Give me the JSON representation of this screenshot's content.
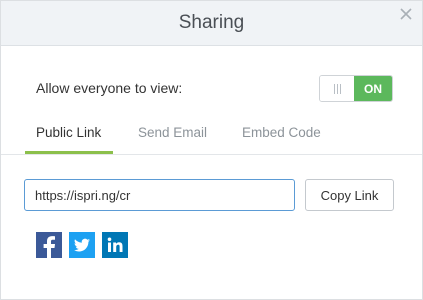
{
  "dialog": {
    "title": "Sharing"
  },
  "allow": {
    "label": "Allow everyone to view:",
    "toggle_state": "ON"
  },
  "tabs": [
    {
      "label": "Public Link",
      "active": true
    },
    {
      "label": "Send Email",
      "active": false
    },
    {
      "label": "Embed Code",
      "active": false
    }
  ],
  "link": {
    "value": "https://ispri.ng/cr",
    "copy_label": "Copy Link"
  },
  "social": [
    {
      "icon": "facebook-icon",
      "color": "#3b5998"
    },
    {
      "icon": "twitter-icon",
      "color": "#1da1f2"
    },
    {
      "icon": "linkedin-icon",
      "color": "#0077b5"
    }
  ],
  "colors": {
    "accent": "#8cc04b",
    "toggle_on": "#5cb85c",
    "input_focus": "#5b9bd5"
  }
}
